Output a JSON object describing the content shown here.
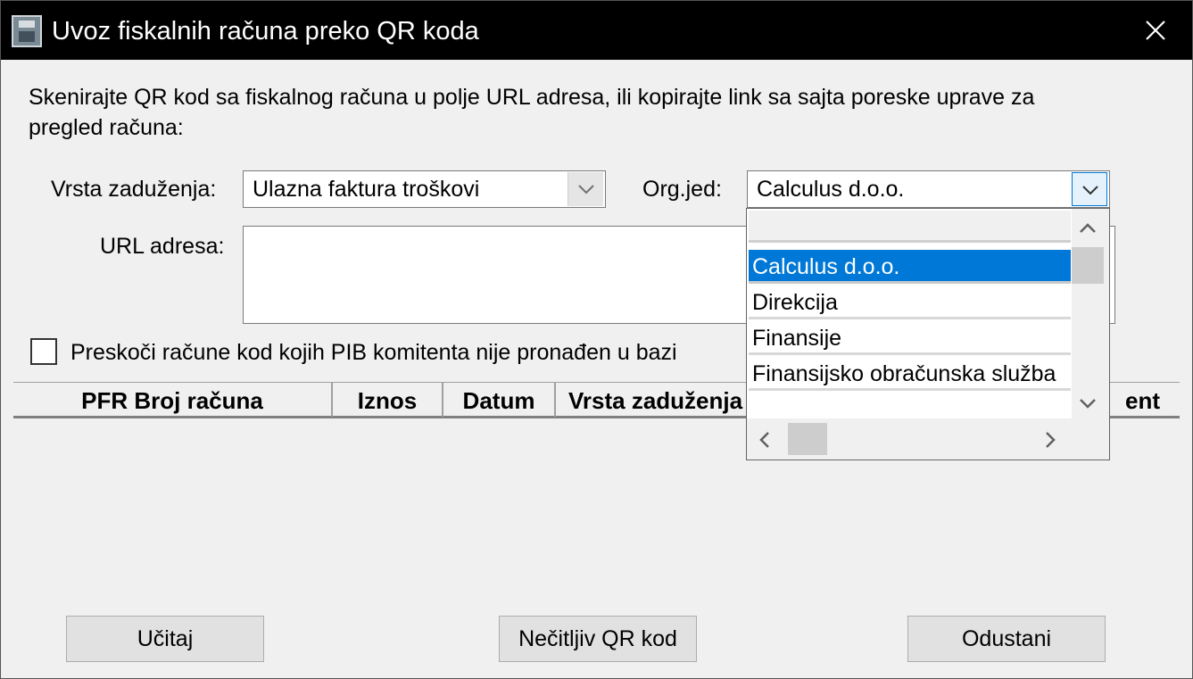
{
  "window": {
    "title": "Uvoz fiskalnih računa preko QR koda"
  },
  "instructions": "Skenirajte QR kod sa fiskalnog računa u polje URL adresa, ili kopirajte link sa sajta poreske uprave za",
  "instructions_line2": "pregled računa:",
  "form": {
    "vrsta_label": "Vrsta zaduženja:",
    "vrsta_value": "Ulazna faktura troškovi",
    "org_label": "Org.jed:",
    "org_value": "Calculus d.o.o.",
    "url_label": "URL adresa:",
    "url_value": ""
  },
  "checkbox": {
    "label": "Preskoči račune kod kojih PIB komitenta nije pronađen u bazi",
    "checked": false
  },
  "grid": {
    "columns": [
      "PFR Broj računa",
      "Iznos",
      "Datum",
      "Vrsta zaduženja",
      "ent"
    ]
  },
  "dropdown": {
    "items": [
      "Calculus d.o.o.",
      "Direkcija",
      "Finansije",
      "Finansijsko obračunska služba"
    ],
    "selected_index": 0
  },
  "buttons": {
    "ucitaj": "Učitaj",
    "necitljiv": "Nečitljiv QR kod",
    "odustani": "Odustani"
  },
  "colors": {
    "selection": "#0078d7",
    "titlebar": "#000000"
  }
}
